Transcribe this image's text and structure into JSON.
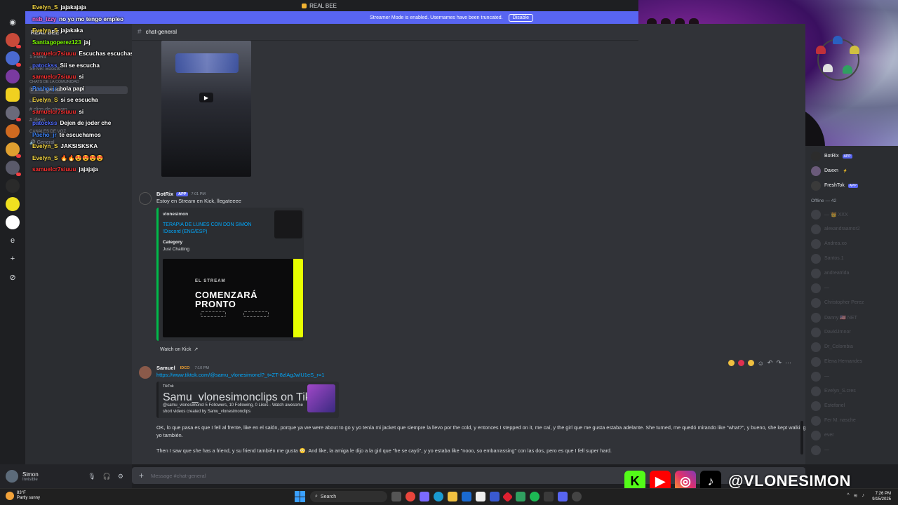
{
  "titlebar": {
    "title": "REAL BEE"
  },
  "banner": {
    "text": "Streamer Mode is enabled. Usernames have been truncated.",
    "button": "Disable"
  },
  "server": {
    "name": "REAL BEE"
  },
  "channels": [
    {
      "name": "1 Event"
    },
    {
      "name": "Server Boosts"
    },
    {
      "name": "CHATS DE LA COMUNIDAD"
    },
    {
      "name": "chat-general"
    },
    {
      "name": "EL STREAM"
    },
    {
      "name": "clips-de-stream"
    },
    {
      "name": "ideas"
    },
    {
      "name": "CANALES DE VOZ"
    },
    {
      "name": "General"
    }
  ],
  "overlay_chat": [
    {
      "user": "Evelyn_S",
      "msg": "jajakajaja",
      "color": "#f5d742"
    },
    {
      "user": "nsb_izzy",
      "msg": "no yo mo tengo empleo",
      "color": "#ff6bd6"
    },
    {
      "user": "Evelyn_S",
      "msg": "jajakaka",
      "color": "#f5d742"
    },
    {
      "user": "Santiagoperez123",
      "msg": "jaj",
      "color": "#7cfc00"
    },
    {
      "user": "samuelcr7siuuu",
      "msg": "Escuchas escuchas",
      "color": "#ff3030"
    },
    {
      "user": "patockss",
      "msg": "Sii se escucha",
      "color": "#4f6bff"
    },
    {
      "user": "samuelcr7siuuu",
      "msg": "si",
      "color": "#ff3030"
    },
    {
      "user": "Pacho_jr",
      "msg": "hola papi",
      "color": "#3b82f6"
    },
    {
      "user": "Evelyn_S",
      "msg": "si se escucha",
      "color": "#f5d742"
    },
    {
      "user": "samuelcr7siuuu",
      "msg": "si",
      "color": "#ff3030"
    },
    {
      "user": "patockss",
      "msg": "Dejen de joder che",
      "color": "#4f6bff"
    },
    {
      "user": "Pacho_jr",
      "msg": "te escuchamos",
      "color": "#3b82f6"
    },
    {
      "user": "Evelyn_S",
      "msg": "JAKSISKSKA",
      "color": "#f5d742"
    },
    {
      "user": "Evelyn_S",
      "msg": "🔥🔥😍😍😍😍",
      "color": "#f5d742"
    },
    {
      "user": "samuelcr7siuuu",
      "msg": "jajajaja",
      "color": "#ff3030"
    }
  ],
  "header": {
    "channel": "chat-general"
  },
  "messages": {
    "botrix": {
      "author": "BotRix",
      "tag": "APP",
      "time": "7:01 PM",
      "text": "Estoy en Stream en Kick, llegateeee",
      "embed": {
        "provider": "vlonesimon",
        "title": "TERAPIA DE LUNES CON DON SIMON !Discord (ENG/ESP)",
        "field_name": "Category",
        "field_value": "Just Chatting",
        "image_small": "EL STREAM",
        "image_big_1": "COMENZARÁ",
        "image_big_2": "PRONTO"
      },
      "watch": "Watch on Kick"
    },
    "samuel": {
      "author": "Samuel",
      "tag": "IDCO",
      "time": "7:10 PM",
      "link": "https://www.tiktok.com/@samu_vlonesimoncl?_t=ZT-8zlAgJwlU1eS_r=1",
      "embed": {
        "provider": "TikTok",
        "title": "Samu_vlonesimonclips on TikTok",
        "desc": "@samu_vlonesimoncl 5 Followers, 10 Following, 0 Likes - Watch awesome short videos created by Samu_vlonesimonclips"
      }
    },
    "paragraph1": "OK, lo que pasa es que I fell al frente, like en el salón, porque ya we were about to go y yo tenía mi jacket que siempre la llevo por the cold, y entonces I stepped on it, me caí, y the girl que me gusta estaba adelante. She turned, me quedó mirando like \"what?\", y bueno, she kept walking, yo también.",
    "paragraph2": "Then I saw que she has a friend, y su friend también me gusta 😳. And like, la amiga le dijo a la girl que \"he se cayó\", y yo estaba like \"nooo, so embarrassing\" con las dos, pero es que I fell super hard."
  },
  "composer": {
    "placeholder": "Message #chat-general"
  },
  "user_panel": {
    "name": "Simon",
    "status": "Invisible"
  },
  "members": {
    "online": [
      {
        "name": "BotRix",
        "tag": "APP"
      },
      {
        "name": "Daxxn",
        "tag": "⚡"
      },
      {
        "name": "FreshTok",
        "tag": "APP"
      }
    ],
    "offline_header": "Offline — 42",
    "offline": [
      {
        "name": "— 👑 XXX"
      },
      {
        "name": "alexandraamor2"
      },
      {
        "name": "Andrea.xo"
      },
      {
        "name": "Santos.1"
      },
      {
        "name": "andreatrida"
      },
      {
        "name": "—"
      },
      {
        "name": "Christopher Perez"
      },
      {
        "name": "Danny 🇺🇸 NET"
      },
      {
        "name": "DavidJrnnor"
      },
      {
        "name": "Dr_Colombia"
      },
      {
        "name": "Elena Hernandes"
      },
      {
        "name": "—"
      },
      {
        "name": "Evelyn_S.cres"
      },
      {
        "name": "Estefanel"
      },
      {
        "name": "Fer M. nasche"
      },
      {
        "name": "ever"
      },
      {
        "name": "—"
      }
    ]
  },
  "social": {
    "handle": "@VLONESIMON"
  },
  "taskbar": {
    "weather_temp": "83°F",
    "weather_desc": "Partly sunny",
    "search": "Search",
    "time": "7:26 PM",
    "date": "9/15/2025"
  }
}
